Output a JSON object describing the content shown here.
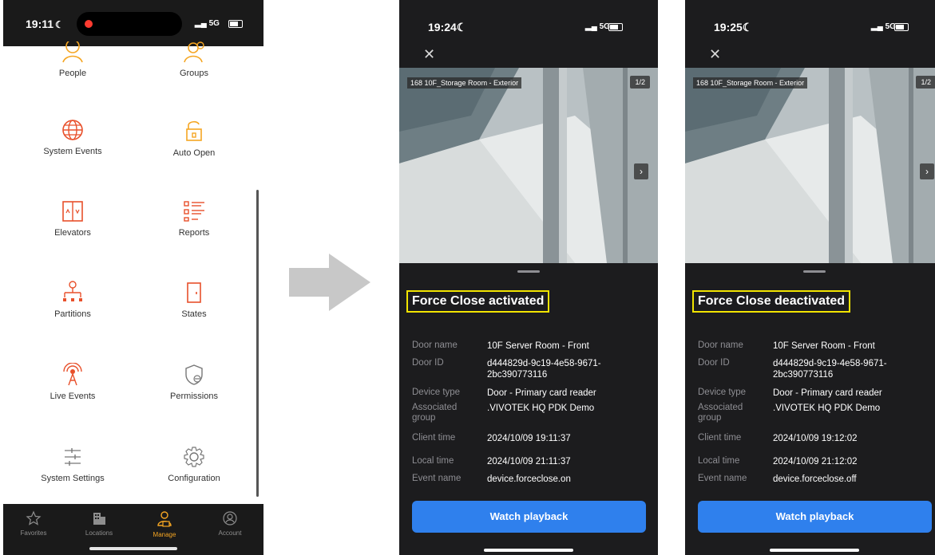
{
  "left_screen": {
    "status": {
      "time": "19:11",
      "network": "5G"
    },
    "tiles": [
      {
        "label": "People",
        "icon": "person-icon"
      },
      {
        "label": "Groups",
        "icon": "group-icon"
      },
      {
        "label": "System Events",
        "icon": "globe-icon"
      },
      {
        "label": "Auto Open",
        "icon": "unlock-icon"
      },
      {
        "label": "Elevators",
        "icon": "elevator-icon"
      },
      {
        "label": "Reports",
        "icon": "list-icon"
      },
      {
        "label": "Partitions",
        "icon": "hierarchy-icon"
      },
      {
        "label": "States",
        "icon": "door-icon"
      },
      {
        "label": "Live Events",
        "icon": "antenna-icon"
      },
      {
        "label": "Permissions",
        "icon": "shield-lock-icon"
      },
      {
        "label": "System Settings",
        "icon": "sliders-icon"
      },
      {
        "label": "Configuration",
        "icon": "gear-icon"
      }
    ],
    "tabbar": [
      {
        "label": "Favorites",
        "icon": "star-icon"
      },
      {
        "label": "Locations",
        "icon": "building-icon"
      },
      {
        "label": "Manage",
        "icon": "manage-icon",
        "active": true
      },
      {
        "label": "Account",
        "icon": "account-icon"
      }
    ],
    "colors": {
      "accent": "#f5a623",
      "icon_red": "#e8502b"
    }
  },
  "arrow_icon": "right-arrow-icon",
  "event_screens": [
    {
      "status": {
        "time": "19:24",
        "network": "5G"
      },
      "camera": {
        "label": "168 10F_Storage Room - Exterior",
        "pager": "1/2"
      },
      "title": "Force Close activated",
      "details": {
        "door_name_label": "Door name",
        "door_name": "10F Server Room - Front",
        "door_id_label": "Door ID",
        "door_id": "d444829d-9c19-4e58-9671-2bc390773116",
        "device_type_label": "Device type",
        "device_type": "Door - Primary card reader",
        "group_label": "Associated group",
        "group": ".VIVOTEK HQ PDK Demo",
        "client_time_label": "Client time",
        "client_time": "2024/10/09 19:11:37",
        "local_time_label": "Local time",
        "local_time": "2024/10/09 21:11:37",
        "event_name_label": "Event name",
        "event_name": "device.forceclose.on"
      },
      "button": "Watch playback"
    },
    {
      "status": {
        "time": "19:25",
        "network": "5G"
      },
      "camera": {
        "label": "168 10F_Storage Room - Exterior",
        "pager": "1/2"
      },
      "title": "Force Close deactivated",
      "details": {
        "door_name_label": "Door name",
        "door_name": "10F Server Room - Front",
        "door_id_label": "Door ID",
        "door_id": "d444829d-9c19-4e58-9671-2bc390773116",
        "device_type_label": "Device type",
        "device_type": "Door - Primary card reader",
        "group_label": "Associated group",
        "group": ".VIVOTEK HQ PDK Demo",
        "client_time_label": "Client time",
        "client_time": "2024/10/09 19:12:02",
        "local_time_label": "Local time",
        "local_time": "2024/10/09 21:12:02",
        "event_name_label": "Event name",
        "event_name": "device.forceclose.off"
      },
      "button": "Watch playback"
    }
  ],
  "colors": {
    "highlight_box": "#f2e400",
    "button_blue": "#2f80ed"
  }
}
